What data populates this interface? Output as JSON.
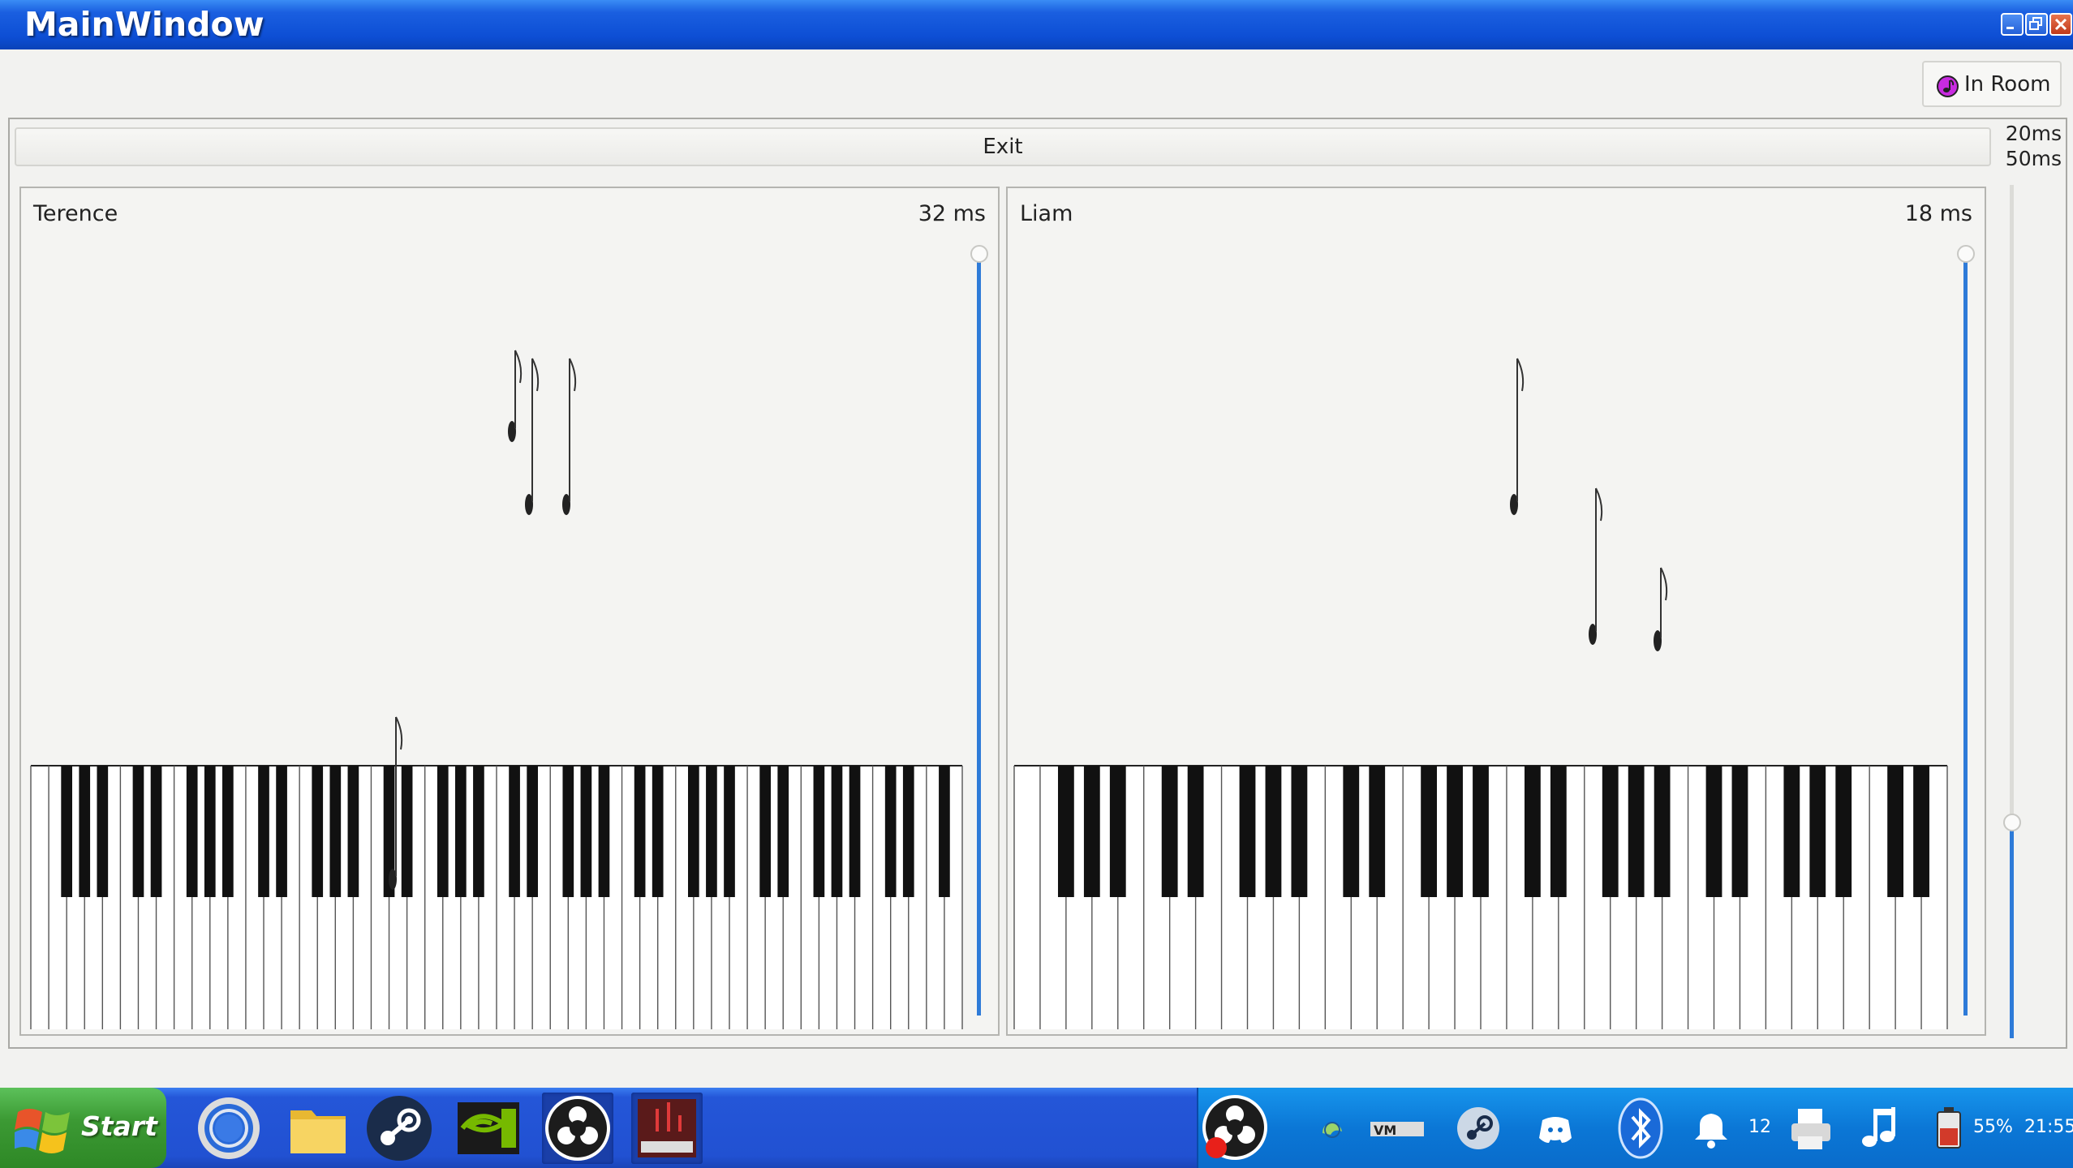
{
  "window": {
    "title": "MainWindow"
  },
  "header": {
    "status_label": "In Room"
  },
  "controls": {
    "exit_label": "Exit",
    "latency_top": "20ms",
    "latency_bottom": "50ms"
  },
  "players": [
    {
      "name": "Terence",
      "latency": "32 ms",
      "slider_level": 1.0
    },
    {
      "name": "Liam",
      "latency": "18 ms",
      "slider_level": 1.0
    }
  ],
  "global_slider_level": 0.25,
  "taskbar": {
    "start_label": "Start",
    "apps": [
      "chrome-icon",
      "folder-icon",
      "steam-icon",
      "nvidia-icon",
      "obs-icon",
      "piano-app-icon"
    ],
    "tray": {
      "notification_count": "12",
      "battery": "55%",
      "clock": "21:55"
    }
  },
  "colors": {
    "accent": "#2e7bd8",
    "titlebar": "#0d4ed4",
    "start": "#3c9a34",
    "status_dot": "#c82be0"
  }
}
